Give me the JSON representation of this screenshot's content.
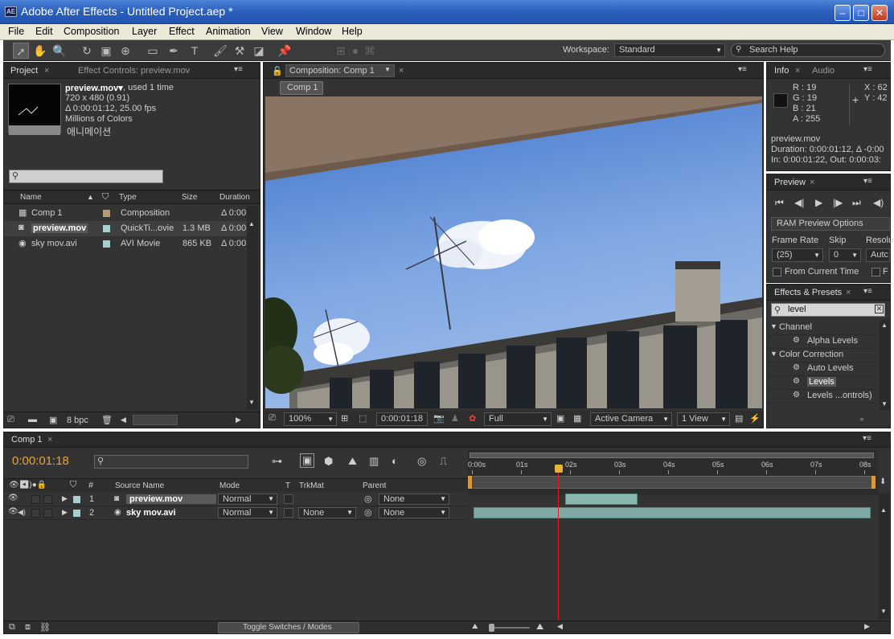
{
  "window": {
    "title": "Adobe After Effects - Untitled Project.aep *",
    "logo": "AE",
    "min": "–",
    "max": "□",
    "close": "✕"
  },
  "menu": [
    "File",
    "Edit",
    "Composition",
    "Layer",
    "Effect",
    "Animation",
    "View",
    "Window",
    "Help"
  ],
  "toolbar": {
    "workspace_label": "Workspace:",
    "workspace_value": "Standard",
    "search_placeholder": "Search Help"
  },
  "project": {
    "tab": "Project",
    "tab2": "Effect Controls: preview.mov",
    "file_name": "preview.mov▾",
    "used": ", used 1 time",
    "dims": "720 x 480 (0.91)",
    "duration": "Δ 0:00:01:12, 25.00 fps",
    "colors": "Millions of Colors",
    "korean": "애니메이션",
    "columns": {
      "name": "Name",
      "type": "Type",
      "size": "Size",
      "duration": "Duration"
    },
    "items": [
      {
        "name": "Comp 1",
        "type": "Composition",
        "size": "",
        "duration": "Δ 0:00",
        "color": "#b59b7a",
        "icon": "composition-icon",
        "selected": false
      },
      {
        "name": "preview.mov",
        "type": "QuickTi...ovie",
        "size": "1.3 MB",
        "duration": "Δ 0:00",
        "color": "#a7cfcf",
        "icon": "quicktime-icon",
        "selected": true
      },
      {
        "name": "sky mov.avi",
        "type": "AVI Movie",
        "size": "865 KB",
        "duration": "Δ 0:00",
        "color": "#a7cfcf",
        "icon": "avi-icon",
        "selected": false
      }
    ],
    "bpc": "8 bpc"
  },
  "comp": {
    "tab": "Composition: Comp 1",
    "crumb": "Comp 1",
    "zoom": "100%",
    "time": "0:00:01:18",
    "resolution": "Full",
    "camera": "Active Camera",
    "view": "1 View"
  },
  "info": {
    "tab": "Info",
    "tab2": "Audio",
    "r": "R : 19",
    "g": "G : 19",
    "b": "B : 21",
    "a": "A : 255",
    "x": "X : 62",
    "y": "Y : 42",
    "file": "preview.mov",
    "duration": "Duration: 0:00:01:12, Δ -0:00",
    "inout": "In: 0:00:01:22, Out: 0:00:03:"
  },
  "preview": {
    "tab": "Preview",
    "ram": "RAM Preview Options",
    "frame_rate_label": "Frame Rate",
    "skip_label": "Skip",
    "res_label": "Resolu",
    "frame_rate": "(25)",
    "skip": "0",
    "res": "Autc",
    "from_current": "From Current Time",
    "full": "F"
  },
  "effects": {
    "tab": "Effects & Presets",
    "search": "level",
    "groups": [
      {
        "name": "Channel",
        "items": [
          "Alpha Levels"
        ]
      },
      {
        "name": "Color Correction",
        "items": [
          "Auto Levels",
          "Levels",
          "Levels ...ontrols)"
        ]
      }
    ],
    "selected": "Levels"
  },
  "timeline": {
    "tab": "Comp 1",
    "time": "0:00:01:18",
    "columns": {
      "num": "#",
      "source": "Source Name",
      "mode": "Mode",
      "t": "T",
      "trkmat": "TrkMat",
      "parent": "Parent"
    },
    "ruler": [
      "0:00s",
      "01s",
      "02s",
      "03s",
      "04s",
      "05s",
      "06s",
      "07s",
      "08s"
    ],
    "layers": [
      {
        "num": "1",
        "name": "preview.mov",
        "mode": "Normal",
        "trkmat": "",
        "parent": "None",
        "color": "#a7cfcf",
        "icon": "quicktime-icon"
      },
      {
        "num": "2",
        "name": "sky mov.avi",
        "mode": "Normal",
        "trkmat": "None",
        "parent": "None",
        "color": "#a7cfcf",
        "icon": "avi-icon"
      }
    ],
    "toggle": "Toggle Switches / Modes"
  }
}
